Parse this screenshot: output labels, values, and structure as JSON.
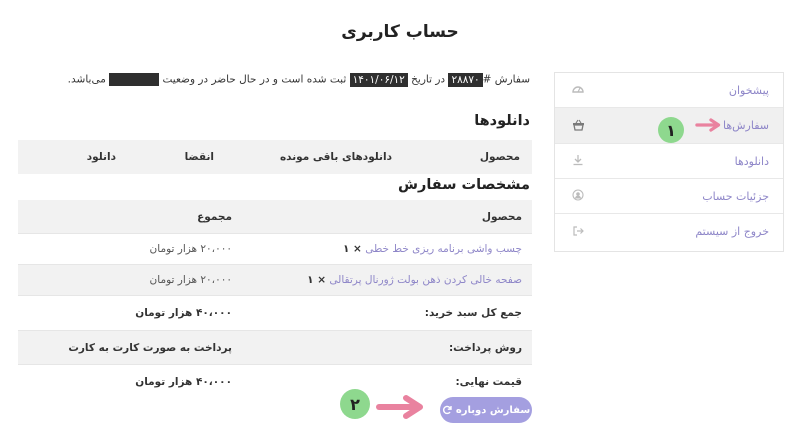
{
  "page": {
    "title": "حساب کاربری"
  },
  "notice": {
    "prefix": "سفارش #",
    "order_number": "۲۸۸۷۰",
    "middle": " در تاریخ ",
    "date": "۱۴۰۱/۰۶/۱۲",
    "suffix": " ثبت شده است و در حال حاضر در وضعیت ",
    "end": " می‌باشد."
  },
  "sidebar": {
    "items": [
      {
        "label": "پیشخوان",
        "icon": "dashboard-icon"
      },
      {
        "label": "سفارش‌ها",
        "icon": "basket-icon"
      },
      {
        "label": "دانلودها",
        "icon": "download-icon"
      },
      {
        "label": "جزئیات حساب",
        "icon": "user-icon"
      },
      {
        "label": "خروج از سیستم",
        "icon": "logout-icon"
      }
    ]
  },
  "downloads": {
    "title": "دانلودها",
    "columns": {
      "product": "محصول",
      "remaining": "دانلودهای باقی مونده",
      "expiry": "انقضا",
      "download": "دانلود"
    }
  },
  "details": {
    "title": "مشخصات سفارش",
    "head": {
      "product": "محصول",
      "total": "مجموع"
    },
    "items": [
      {
        "name": "چسب واشی برنامه ریزی خط خطی",
        "qty": "× ۱",
        "price": "۲۰،۰۰۰ هزار تومان"
      },
      {
        "name": "صفحه خالی کردن ذهن بولت ژورنال پرتقالی",
        "qty": "× ۱",
        "price": "۲۰،۰۰۰ هزار تومان"
      }
    ],
    "subtotal": {
      "label": "جمع کل سبد خرید:",
      "value": "۴۰،۰۰۰ هزار تومان"
    },
    "payment": {
      "label": "روش پرداخت:",
      "value": "پرداخت به صورت کارت به کارت"
    },
    "final": {
      "label": "قیمت نهایی:",
      "value": "۴۰،۰۰۰ هزار تومان"
    }
  },
  "actions": {
    "reorder": "سفارش دوباره"
  },
  "annotations": {
    "badge1": "۱",
    "badge2": "۲"
  },
  "colors": {
    "accent": "#8e86c8",
    "button": "#a49fe0",
    "badge": "#8ed88e",
    "arrow": "#e9829f"
  }
}
